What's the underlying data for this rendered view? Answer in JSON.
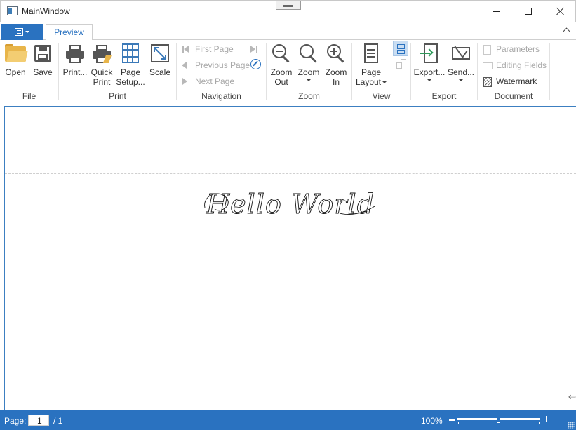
{
  "window": {
    "title": "MainWindow"
  },
  "ribbon": {
    "tabs": [
      {
        "label": "Preview"
      }
    ],
    "groups": {
      "file": {
        "label": "File",
        "open": "Open",
        "save": "Save"
      },
      "print": {
        "label": "Print",
        "print": "Print...",
        "quick_print_l1": "Quick",
        "quick_print_l2": "Print",
        "page_setup_l1": "Page",
        "page_setup_l2": "Setup...",
        "scale": "Scale"
      },
      "navigation": {
        "label": "Navigation",
        "first_page": "First Page",
        "previous_page": "Previous Page",
        "next_page": "Next Page"
      },
      "zoom": {
        "label": "Zoom",
        "zoom_out_l1": "Zoom",
        "zoom_out_l2": "Out",
        "zoom": "Zoom",
        "zoom_in_l1": "Zoom",
        "zoom_in_l2": "In"
      },
      "view": {
        "label": "View",
        "page_layout_l1": "Page",
        "page_layout_l2": "Layout"
      },
      "export": {
        "label": "Export",
        "export": "Export...",
        "send": "Send..."
      },
      "document": {
        "label": "Document",
        "parameters": "Parameters",
        "editing_fields": "Editing Fields",
        "watermark": "Watermark"
      }
    }
  },
  "document": {
    "text": "Hello World"
  },
  "status_bar": {
    "page_label": "Page:",
    "current_page": "1",
    "total_pages": "/ 1",
    "zoom_level": "100%",
    "zoom_fraction": 0.5
  },
  "colors": {
    "accent": "#2a72c0",
    "disabled": "#a8a8a8"
  },
  "icons": [
    "app-icon",
    "minimize-icon",
    "maximize-icon",
    "close-icon",
    "folder-open-icon",
    "save-icon",
    "printer-icon",
    "quick-print-icon",
    "page-setup-icon",
    "scale-icon",
    "first-page-icon",
    "previous-page-icon",
    "next-page-icon",
    "last-page-icon",
    "navigate-icon",
    "zoom-out-icon",
    "zoom-icon",
    "zoom-in-icon",
    "page-layout-icon",
    "continuous-view-icon",
    "facing-view-icon",
    "export-icon",
    "send-icon",
    "parameters-icon",
    "editing-fields-icon",
    "watermark-icon"
  ]
}
